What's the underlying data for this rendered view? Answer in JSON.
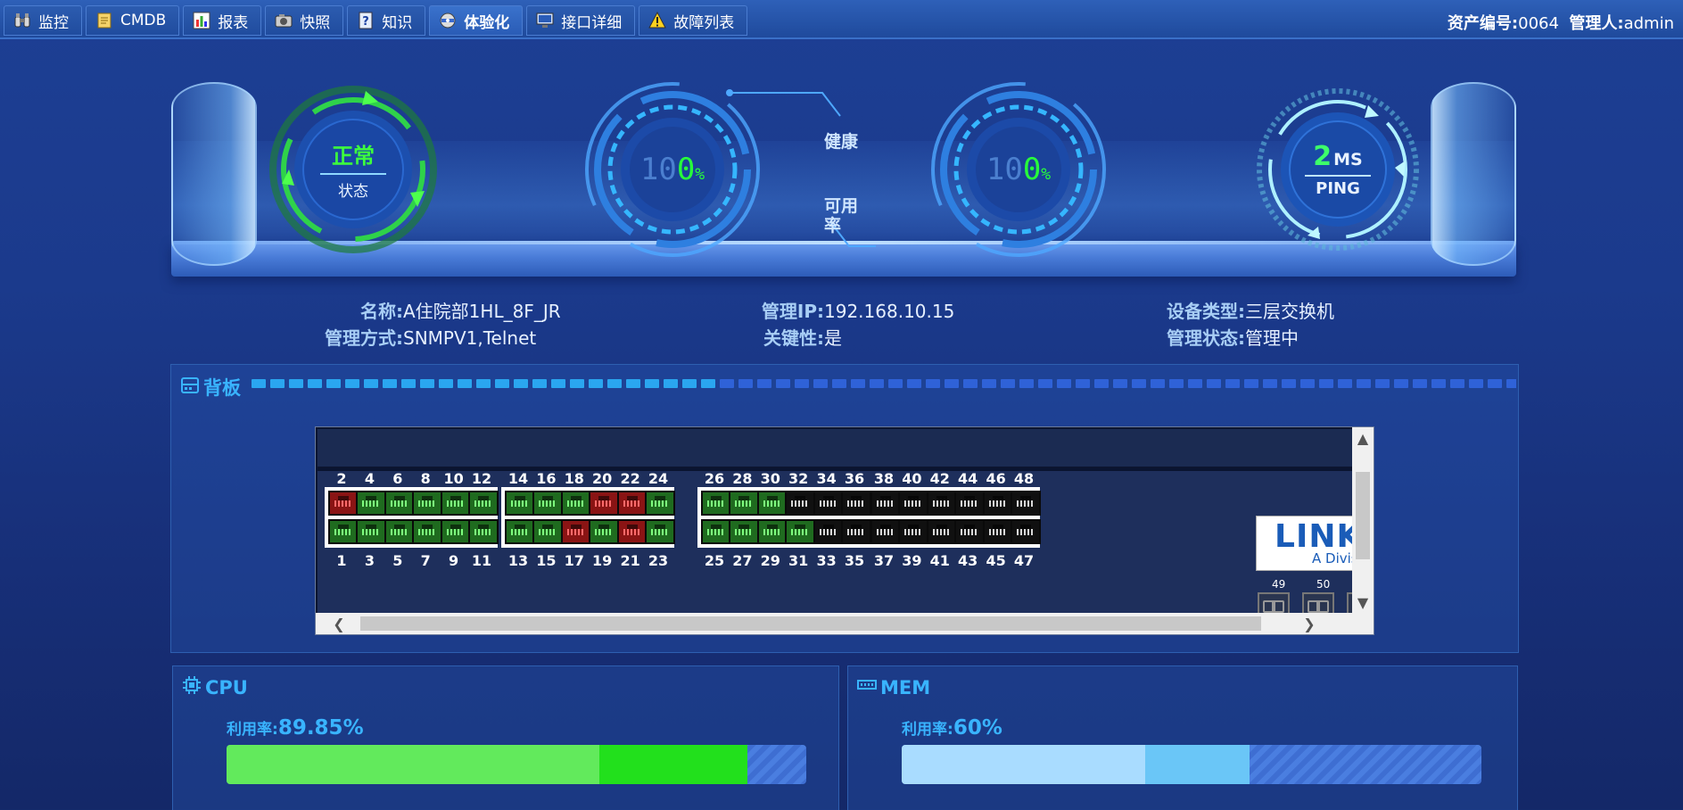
{
  "tabs": [
    {
      "label": "监控",
      "icon": "binoculars-icon",
      "active": false
    },
    {
      "label": "CMDB",
      "icon": "document-icon",
      "active": false
    },
    {
      "label": "报表",
      "icon": "bar-chart-icon",
      "active": false
    },
    {
      "label": "快照",
      "icon": "camera-icon",
      "active": false
    },
    {
      "label": "知识",
      "icon": "help-book-icon",
      "active": false
    },
    {
      "label": "体验化",
      "icon": "disc-icon",
      "active": true
    },
    {
      "label": "接口详细",
      "icon": "monitor-icon",
      "active": false
    },
    {
      "label": "故障列表",
      "icon": "warning-icon",
      "active": false
    }
  ],
  "header_info": {
    "asset_label": "资产编号:",
    "asset_value": "0064",
    "manager_label": "管理人:",
    "manager_value": "admin"
  },
  "hero": {
    "status_value": "正常",
    "status_label": "状态",
    "health_label": "健康",
    "health_dim": "10",
    "health_hi": "0",
    "health_unit": "%",
    "availability_label": "可用率",
    "availability_dim": "10",
    "availability_hi": "0",
    "availability_unit": "%",
    "ping_value": "2",
    "ping_unit": "MS",
    "ping_label": "PING"
  },
  "device_info": {
    "name_label": "名称:",
    "name_value": "A住院部1HL_8F_JR",
    "mgmt_mode_label": "管理方式:",
    "mgmt_mode_value": "SNMPV1,Telnet",
    "mgmt_ip_label": "管理IP:",
    "mgmt_ip_value": "192.168.10.15",
    "critical_label": "关键性:",
    "critical_value": "是",
    "device_type_label": "设备类型:",
    "device_type_value": "三层交换机",
    "mgmt_status_label": "管理状态:",
    "mgmt_status_value": "管理中"
  },
  "backplane": {
    "title": "背板",
    "logo_text": "LINKS",
    "logo_sub": "A Divisi",
    "top_numbers": [
      "2",
      "4",
      "6",
      "8",
      "10",
      "12",
      "14",
      "16",
      "18",
      "20",
      "22",
      "24",
      "26",
      "28",
      "30",
      "32",
      "34",
      "36",
      "38",
      "40",
      "42",
      "44",
      "46",
      "48"
    ],
    "bottom_numbers": [
      "1",
      "3",
      "5",
      "7",
      "9",
      "11",
      "13",
      "15",
      "17",
      "19",
      "21",
      "23",
      "25",
      "27",
      "29",
      "31",
      "33",
      "35",
      "37",
      "39",
      "41",
      "43",
      "45",
      "47"
    ],
    "top_status": [
      "red",
      "green",
      "green",
      "green",
      "green",
      "green",
      "green",
      "green",
      "green",
      "red",
      "red",
      "green",
      "green",
      "green",
      "green",
      "black",
      "black",
      "black",
      "black",
      "black",
      "black",
      "black",
      "black",
      "black"
    ],
    "bottom_status": [
      "green",
      "green",
      "green",
      "green",
      "green",
      "green",
      "green",
      "green",
      "red",
      "green",
      "red",
      "green",
      "green",
      "green",
      "green",
      "green",
      "black",
      "black",
      "black",
      "black",
      "black",
      "black",
      "black",
      "black"
    ],
    "sfp_labels": [
      "49",
      "50"
    ],
    "colors": {
      "up": "#1f6b1f",
      "down": "#8a1414",
      "unused": "#101010"
    }
  },
  "cpu": {
    "title": "CPU",
    "util_label": "利用率:",
    "util_value": "89.85%",
    "usage": 89.85
  },
  "mem": {
    "title": "MEM",
    "util_label": "利用率:",
    "util_value": "60%",
    "usage": 60
  }
}
